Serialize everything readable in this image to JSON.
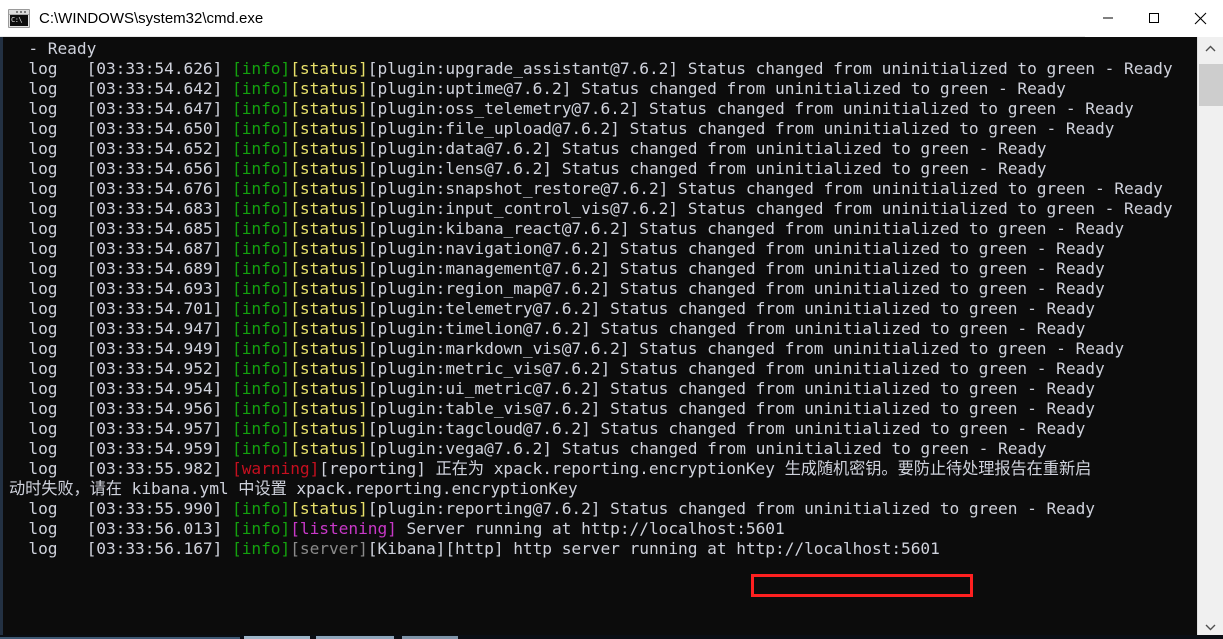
{
  "window": {
    "title": "C:\\WINDOWS\\system32\\cmd.exe",
    "icon": "cmd-console-icon",
    "icon_glyph": "C:\\",
    "controls": {
      "minimize": "minimize-button",
      "maximize": "maximize-button",
      "close": "close-button"
    }
  },
  "colors": {
    "background": "#0c0c0c",
    "foreground": "#cfd2dc",
    "info": "#13a10e",
    "status": "#e8e06a",
    "warning": "#c50f1f",
    "listening": "#c838c8",
    "server": "#8a8a8a",
    "annotation": "#ff2020",
    "titlebar": "#ffffff",
    "scrollbar_track": "#f0f0f0",
    "scrollbar_thumb": "#cdcdcd"
  },
  "annotation": {
    "type": "red-rectangle",
    "target_text": "http://localhost:5601"
  },
  "scrollbar": {
    "up_arrow": "scroll-up-arrow",
    "down_arrow": "scroll-down-arrow",
    "thumb": "scroll-thumb"
  },
  "console": {
    "lines": [
      {
        "segments": [
          {
            "t": "  - Ready",
            "c": "c-def"
          }
        ]
      },
      {
        "segments": [
          {
            "t": "  log   [03:33:54.626] ",
            "c": "c-def"
          },
          {
            "t": "[info]",
            "c": "c-green"
          },
          {
            "t": "[status]",
            "c": "c-yellow"
          },
          {
            "t": "[plugin:upgrade_assistant@7.6.2] Status changed from uninitialized to green - Ready",
            "c": "c-def"
          }
        ]
      },
      {
        "segments": [
          {
            "t": "  log   [03:33:54.642] ",
            "c": "c-def"
          },
          {
            "t": "[info]",
            "c": "c-green"
          },
          {
            "t": "[status]",
            "c": "c-yellow"
          },
          {
            "t": "[plugin:uptime@7.6.2] Status changed from uninitialized to green - Ready",
            "c": "c-def"
          }
        ]
      },
      {
        "segments": [
          {
            "t": "  log   [03:33:54.647] ",
            "c": "c-def"
          },
          {
            "t": "[info]",
            "c": "c-green"
          },
          {
            "t": "[status]",
            "c": "c-yellow"
          },
          {
            "t": "[plugin:oss_telemetry@7.6.2] Status changed from uninitialized to green - Ready",
            "c": "c-def"
          }
        ]
      },
      {
        "segments": [
          {
            "t": "  log   [03:33:54.650] ",
            "c": "c-def"
          },
          {
            "t": "[info]",
            "c": "c-green"
          },
          {
            "t": "[status]",
            "c": "c-yellow"
          },
          {
            "t": "[plugin:file_upload@7.6.2] Status changed from uninitialized to green - Ready",
            "c": "c-def"
          }
        ]
      },
      {
        "segments": [
          {
            "t": "  log   [03:33:54.652] ",
            "c": "c-def"
          },
          {
            "t": "[info]",
            "c": "c-green"
          },
          {
            "t": "[status]",
            "c": "c-yellow"
          },
          {
            "t": "[plugin:data@7.6.2] Status changed from uninitialized to green - Ready",
            "c": "c-def"
          }
        ]
      },
      {
        "segments": [
          {
            "t": "  log   [03:33:54.656] ",
            "c": "c-def"
          },
          {
            "t": "[info]",
            "c": "c-green"
          },
          {
            "t": "[status]",
            "c": "c-yellow"
          },
          {
            "t": "[plugin:lens@7.6.2] Status changed from uninitialized to green - Ready",
            "c": "c-def"
          }
        ]
      },
      {
        "segments": [
          {
            "t": "  log   [03:33:54.676] ",
            "c": "c-def"
          },
          {
            "t": "[info]",
            "c": "c-green"
          },
          {
            "t": "[status]",
            "c": "c-yellow"
          },
          {
            "t": "[plugin:snapshot_restore@7.6.2] Status changed from uninitialized to green - Ready",
            "c": "c-def"
          }
        ]
      },
      {
        "segments": [
          {
            "t": "  log   [03:33:54.683] ",
            "c": "c-def"
          },
          {
            "t": "[info]",
            "c": "c-green"
          },
          {
            "t": "[status]",
            "c": "c-yellow"
          },
          {
            "t": "[plugin:input_control_vis@7.6.2] Status changed from uninitialized to green - Ready",
            "c": "c-def"
          }
        ]
      },
      {
        "segments": [
          {
            "t": "  log   [03:33:54.685] ",
            "c": "c-def"
          },
          {
            "t": "[info]",
            "c": "c-green"
          },
          {
            "t": "[status]",
            "c": "c-yellow"
          },
          {
            "t": "[plugin:kibana_react@7.6.2] Status changed from uninitialized to green - Ready",
            "c": "c-def"
          }
        ]
      },
      {
        "segments": [
          {
            "t": "  log   [03:33:54.687] ",
            "c": "c-def"
          },
          {
            "t": "[info]",
            "c": "c-green"
          },
          {
            "t": "[status]",
            "c": "c-yellow"
          },
          {
            "t": "[plugin:navigation@7.6.2] Status changed from uninitialized to green - Ready",
            "c": "c-def"
          }
        ]
      },
      {
        "segments": [
          {
            "t": "  log   [03:33:54.689] ",
            "c": "c-def"
          },
          {
            "t": "[info]",
            "c": "c-green"
          },
          {
            "t": "[status]",
            "c": "c-yellow"
          },
          {
            "t": "[plugin:management@7.6.2] Status changed from uninitialized to green - Ready",
            "c": "c-def"
          }
        ]
      },
      {
        "segments": [
          {
            "t": "  log   [03:33:54.693] ",
            "c": "c-def"
          },
          {
            "t": "[info]",
            "c": "c-green"
          },
          {
            "t": "[status]",
            "c": "c-yellow"
          },
          {
            "t": "[plugin:region_map@7.6.2] Status changed from uninitialized to green - Ready",
            "c": "c-def"
          }
        ]
      },
      {
        "segments": [
          {
            "t": "  log   [03:33:54.701] ",
            "c": "c-def"
          },
          {
            "t": "[info]",
            "c": "c-green"
          },
          {
            "t": "[status]",
            "c": "c-yellow"
          },
          {
            "t": "[plugin:telemetry@7.6.2] Status changed from uninitialized to green - Ready",
            "c": "c-def"
          }
        ]
      },
      {
        "segments": [
          {
            "t": "  log   [03:33:54.947] ",
            "c": "c-def"
          },
          {
            "t": "[info]",
            "c": "c-green"
          },
          {
            "t": "[status]",
            "c": "c-yellow"
          },
          {
            "t": "[plugin:timelion@7.6.2] Status changed from uninitialized to green - Ready",
            "c": "c-def"
          }
        ]
      },
      {
        "segments": [
          {
            "t": "  log   [03:33:54.949] ",
            "c": "c-def"
          },
          {
            "t": "[info]",
            "c": "c-green"
          },
          {
            "t": "[status]",
            "c": "c-yellow"
          },
          {
            "t": "[plugin:markdown_vis@7.6.2] Status changed from uninitialized to green - Ready",
            "c": "c-def"
          }
        ]
      },
      {
        "segments": [
          {
            "t": "  log   [03:33:54.952] ",
            "c": "c-def"
          },
          {
            "t": "[info]",
            "c": "c-green"
          },
          {
            "t": "[status]",
            "c": "c-yellow"
          },
          {
            "t": "[plugin:metric_vis@7.6.2] Status changed from uninitialized to green - Ready",
            "c": "c-def"
          }
        ]
      },
      {
        "segments": [
          {
            "t": "  log   [03:33:54.954] ",
            "c": "c-def"
          },
          {
            "t": "[info]",
            "c": "c-green"
          },
          {
            "t": "[status]",
            "c": "c-yellow"
          },
          {
            "t": "[plugin:ui_metric@7.6.2] Status changed from uninitialized to green - Ready",
            "c": "c-def"
          }
        ]
      },
      {
        "segments": [
          {
            "t": "  log   [03:33:54.956] ",
            "c": "c-def"
          },
          {
            "t": "[info]",
            "c": "c-green"
          },
          {
            "t": "[status]",
            "c": "c-yellow"
          },
          {
            "t": "[plugin:table_vis@7.6.2] Status changed from uninitialized to green - Ready",
            "c": "c-def"
          }
        ]
      },
      {
        "segments": [
          {
            "t": "  log   [03:33:54.957] ",
            "c": "c-def"
          },
          {
            "t": "[info]",
            "c": "c-green"
          },
          {
            "t": "[status]",
            "c": "c-yellow"
          },
          {
            "t": "[plugin:tagcloud@7.6.2] Status changed from uninitialized to green - Ready",
            "c": "c-def"
          }
        ]
      },
      {
        "segments": [
          {
            "t": "  log   [03:33:54.959] ",
            "c": "c-def"
          },
          {
            "t": "[info]",
            "c": "c-green"
          },
          {
            "t": "[status]",
            "c": "c-yellow"
          },
          {
            "t": "[plugin:vega@7.6.2] Status changed from uninitialized to green - Ready",
            "c": "c-def"
          }
        ]
      },
      {
        "segments": [
          {
            "t": "  log   [03:33:55.982] ",
            "c": "c-def"
          },
          {
            "t": "[warning]",
            "c": "c-red"
          },
          {
            "t": "[reporting] 正在为 xpack.reporting.encryptionKey 生成随机密钥。要防止待处理报告在重新启",
            "c": "c-def"
          }
        ]
      },
      {
        "segments": [
          {
            "t": "动时失败，请在 kibana.yml 中设置 xpack.reporting.encryptionKey",
            "c": "c-def"
          }
        ]
      },
      {
        "segments": [
          {
            "t": "  log   [03:33:55.990] ",
            "c": "c-def"
          },
          {
            "t": "[info]",
            "c": "c-green"
          },
          {
            "t": "[status]",
            "c": "c-yellow"
          },
          {
            "t": "[plugin:reporting@7.6.2] Status changed from uninitialized to green - Ready",
            "c": "c-def"
          }
        ]
      },
      {
        "segments": [
          {
            "t": "  log   [03:33:56.013] ",
            "c": "c-def"
          },
          {
            "t": "[info]",
            "c": "c-green"
          },
          {
            "t": "[listening]",
            "c": "c-mag"
          },
          {
            "t": " Server running at http://localhost:5601",
            "c": "c-def"
          }
        ]
      },
      {
        "segments": [
          {
            "t": "  log   [03:33:56.167] ",
            "c": "c-def"
          },
          {
            "t": "[info]",
            "c": "c-green"
          },
          {
            "t": "[server]",
            "c": "c-gray"
          },
          {
            "t": "[Kibana][http] http server running at http://localhost:5601",
            "c": "c-def"
          }
        ]
      }
    ]
  }
}
